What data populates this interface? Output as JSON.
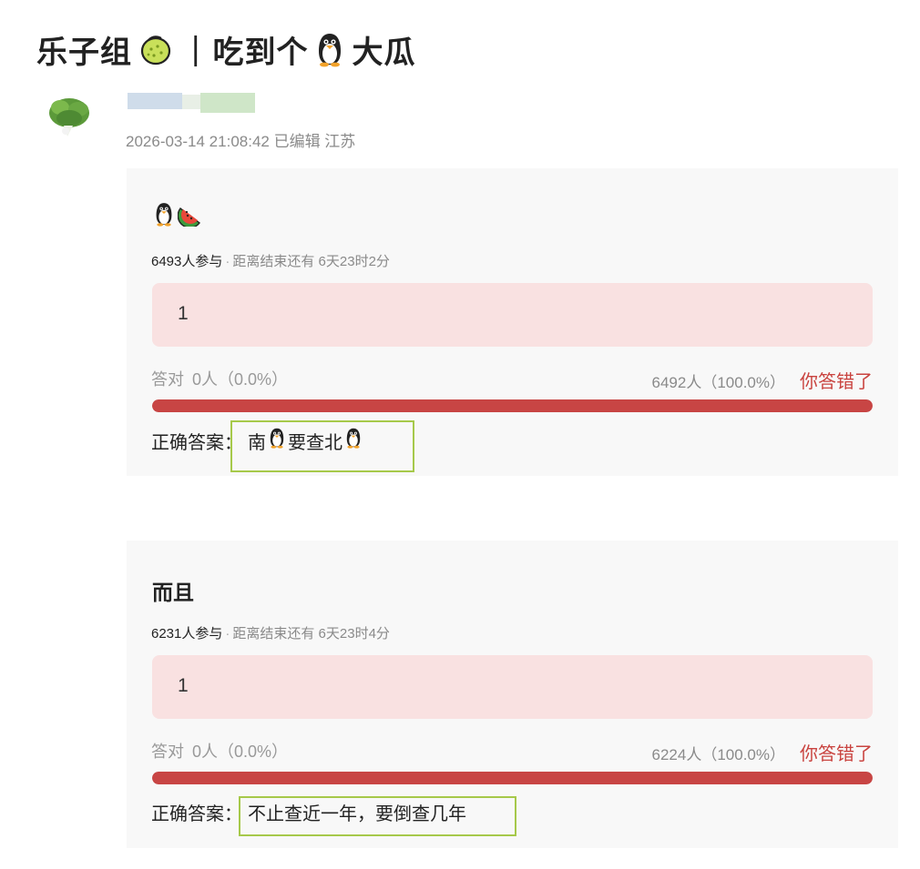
{
  "post": {
    "title_part1": "乐子组",
    "title_sep": "|",
    "title_part2": "吃到个",
    "title_part3": "大瓜",
    "title_icons": [
      "lemon-icon",
      "penguin-icon"
    ],
    "meta": "2026-03-14 21:08:42 已编辑 江苏"
  },
  "quizzes": [
    {
      "title_icons": [
        "penguin-icon",
        "watermelon-icon"
      ],
      "participants": "6493人参与",
      "remaining": "距离结束还有 6天23时2分",
      "option": "1",
      "correct_label": "答对",
      "correct_stat": "0人（0.0%）",
      "option_stat": "6492人（100.0%）",
      "result_tag": "你答错了",
      "option_share": 1.0,
      "answer_label": "正确答案：",
      "answer_text_a": "南",
      "answer_text_b": "要查北",
      "answer_icons": [
        "penguin-icon",
        "penguin-icon"
      ]
    },
    {
      "title": "而且",
      "participants": "6231人参与",
      "remaining": "距离结束还有 6天23时4分",
      "option": "1",
      "correct_label": "答对",
      "correct_stat": "0人（0.0%）",
      "option_stat": "6224人（100.0%）",
      "result_tag": "你答错了",
      "option_share": 1.0,
      "answer_label": "正确答案：",
      "answer_text": "不止查近一年，要倒查几年"
    }
  ],
  "colors": {
    "accent_red": "#c84544",
    "option_bg": "#f9e1e1",
    "card_bg": "#f8f8f8",
    "highlight": "#a6c94a"
  }
}
